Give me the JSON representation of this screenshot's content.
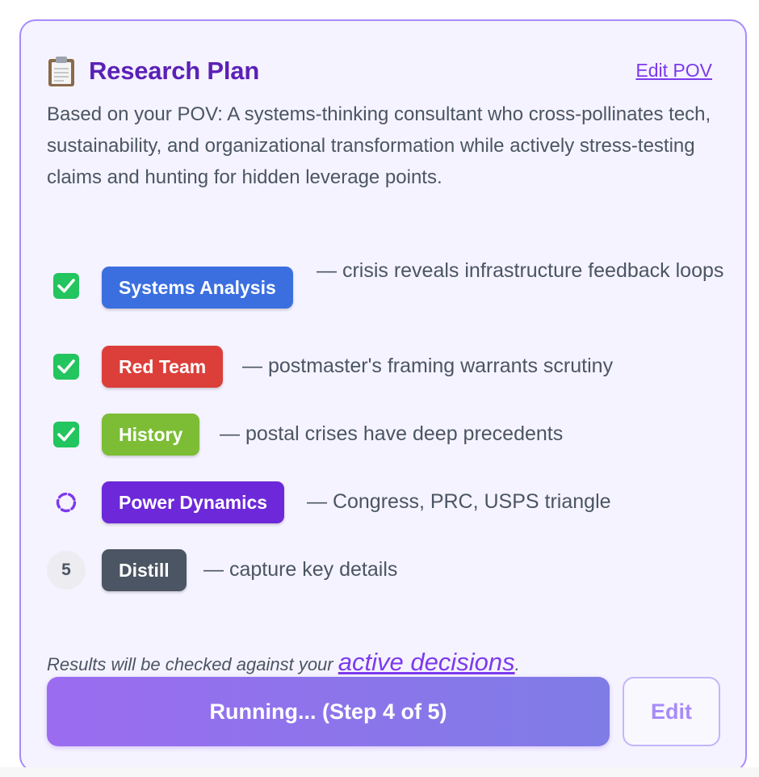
{
  "card": {
    "title": "Research Plan",
    "icon": "clipboard-icon",
    "edit_pov_label": "Edit POV",
    "description": "Based on your POV: A systems-thinking consultant who cross-pollinates tech, sustainability, and organizational transformation while actively stress-testing claims and hunting for hidden leverage points."
  },
  "steps": [
    {
      "status": "done",
      "status_icon": "check-icon",
      "tag": "Systems Analysis",
      "tag_color": "#3b6fe0",
      "text": "— crisis reveals infrastructure feedback loops"
    },
    {
      "status": "done",
      "status_icon": "check-icon",
      "tag": "Red Team",
      "tag_color": "#dc3f3a",
      "text": "— postmaster's framing warrants scrutiny"
    },
    {
      "status": "done",
      "status_icon": "check-icon",
      "tag": "History",
      "tag_color": "#7cbd35",
      "text": "— postal crises have deep precedents"
    },
    {
      "status": "running",
      "status_icon": "spinner-icon",
      "tag": "Power Dynamics",
      "tag_color": "#6d28d9",
      "text": "— Congress, PRC, USPS triangle"
    },
    {
      "status": "pending",
      "number": "5",
      "tag": "Distill",
      "tag_color": "#4b5563",
      "text": "— capture key details"
    }
  ],
  "note": {
    "prefix": "Results will be checked against your ",
    "link": "active decisions",
    "suffix": "."
  },
  "actions": {
    "run_label": "Running... (Step 4 of 5)",
    "edit_label": "Edit"
  },
  "colors": {
    "accent": "#7c3aed",
    "title": "#5b21b6",
    "card_bg": "#f5f3ff",
    "card_border": "#a78bfa"
  }
}
